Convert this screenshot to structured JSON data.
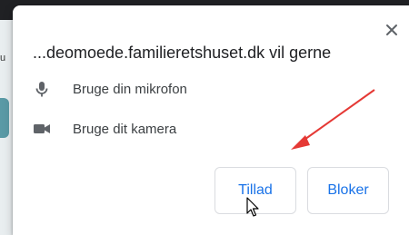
{
  "background": {
    "fragment_text": "u"
  },
  "dialog": {
    "title": "...deomoede.familieretshuset.dk vil gerne",
    "permissions": [
      {
        "icon": "microphone-icon",
        "label": "Bruge din mikrofon"
      },
      {
        "icon": "camera-icon",
        "label": "Bruge dit kamera"
      }
    ],
    "allow_label": "Tillad",
    "block_label": "Bloker",
    "close_symbol": "×"
  },
  "colors": {
    "accent": "#1a73e8",
    "annotation_arrow": "#e53935"
  }
}
